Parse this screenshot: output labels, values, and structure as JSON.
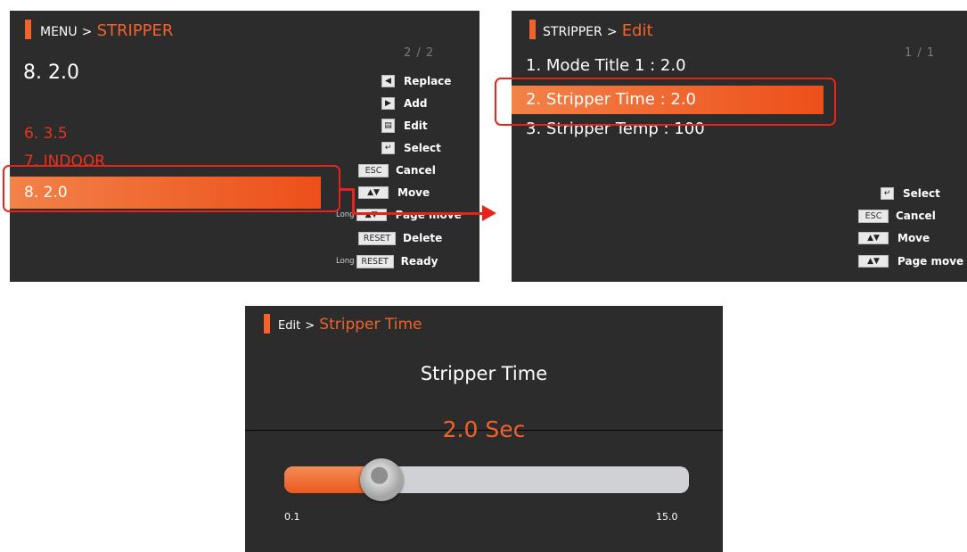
{
  "screen1": {
    "breadcrumb": {
      "path": "MENU",
      "sep": ">",
      "current": "STRIPPER"
    },
    "page_indicator": "2 / 2",
    "current_value": "8. 2.0",
    "items": [
      {
        "label": "6. 3.5"
      },
      {
        "label": "7. INDOOR"
      }
    ],
    "selected_item": "8. 2.0",
    "keys": [
      {
        "long": "",
        "key": "◀",
        "label": "Replace"
      },
      {
        "long": "",
        "key": "▶",
        "label": "Add"
      },
      {
        "long": "",
        "key": "▤",
        "label": "Edit"
      },
      {
        "long": "",
        "key": "↵",
        "label": "Select"
      },
      {
        "long": "",
        "key": "ESC",
        "label": "Cancel"
      },
      {
        "long": "",
        "key": "▲▼",
        "label": "Move"
      },
      {
        "long": "Long",
        "key": "▲▼",
        "label": "Page move"
      },
      {
        "long": "",
        "key": "RESET",
        "label": "Delete"
      },
      {
        "long": "Long",
        "key": "RESET",
        "label": "Ready"
      }
    ]
  },
  "screen2": {
    "breadcrumb": {
      "path": "STRIPPER",
      "sep": ">",
      "current": "Edit"
    },
    "page_indicator": "1 / 1",
    "items": [
      {
        "label": "1. Mode Title 1 : 2.0"
      },
      {
        "label": "2. Stripper Time : 2.0"
      },
      {
        "label": "3. Stripper Temp : 100"
      }
    ],
    "keys": [
      {
        "key": "↵",
        "label": "Select"
      },
      {
        "key": "ESC",
        "label": "Cancel"
      },
      {
        "key": "▲▼",
        "label": "Move"
      },
      {
        "key": "▲▼",
        "label": "Page move"
      }
    ]
  },
  "screen3": {
    "breadcrumb": {
      "path": "Edit",
      "sep": ">",
      "current": "Stripper Time"
    },
    "title": "Stripper Time",
    "value_text": "2.0 Sec",
    "slider": {
      "min_label": "0.1",
      "max_label": "15.0",
      "min": 0.1,
      "max": 15.0,
      "value": 2.0
    }
  },
  "colors": {
    "accent": "#f2622a",
    "highlight_outline": "#e8231b",
    "screen_bg": "#2c2c2c"
  }
}
